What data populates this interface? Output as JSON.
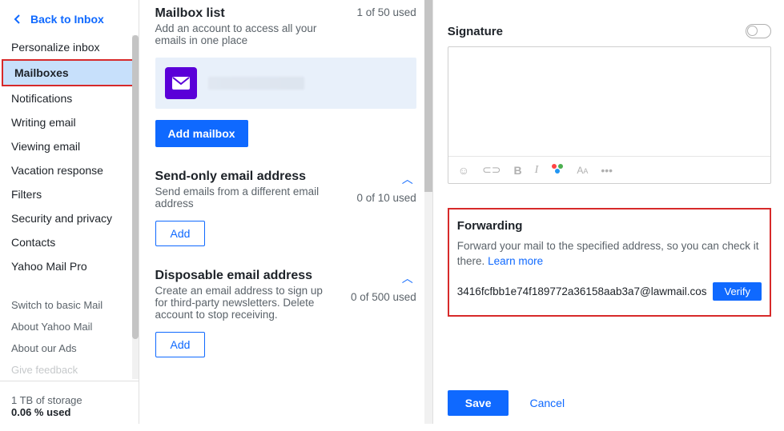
{
  "sidebar": {
    "back_label": "Back to Inbox",
    "items": [
      {
        "label": "Personalize inbox"
      },
      {
        "label": "Mailboxes"
      },
      {
        "label": "Notifications"
      },
      {
        "label": "Writing email"
      },
      {
        "label": "Viewing email"
      },
      {
        "label": "Vacation response"
      },
      {
        "label": "Filters"
      },
      {
        "label": "Security and privacy"
      },
      {
        "label": "Contacts"
      },
      {
        "label": "Yahoo Mail Pro"
      }
    ],
    "secondary": [
      {
        "label": "Switch to basic Mail"
      },
      {
        "label": "About Yahoo Mail"
      },
      {
        "label": "About our Ads"
      },
      {
        "label": "Give feedback"
      }
    ],
    "storage_line1": "1 TB of storage",
    "storage_line2": "0.06 % used"
  },
  "mailbox_list": {
    "title": "Mailbox list",
    "desc": "Add an account to access all your emails in one place",
    "count": "1 of 50 used",
    "add_btn": "Add mailbox"
  },
  "send_only": {
    "title": "Send-only email address",
    "desc": "Send emails from a different email address",
    "count": "0 of 10 used",
    "add_btn": "Add"
  },
  "disposable": {
    "title": "Disposable email address",
    "desc": "Create an email address to sign up for third-party newsletters. Delete account to stop receiving.",
    "count": "0 of 500 used",
    "add_btn": "Add"
  },
  "signature": {
    "title": "Signature"
  },
  "forwarding": {
    "title": "Forwarding",
    "desc": "Forward your mail to the specified address, so you can check it there. ",
    "learn_more": "Learn more",
    "email": "3416fcfbb1e74f189772a36158aab3a7@lawmail.cos",
    "verify_btn": "Verify"
  },
  "footer": {
    "save": "Save",
    "cancel": "Cancel"
  }
}
